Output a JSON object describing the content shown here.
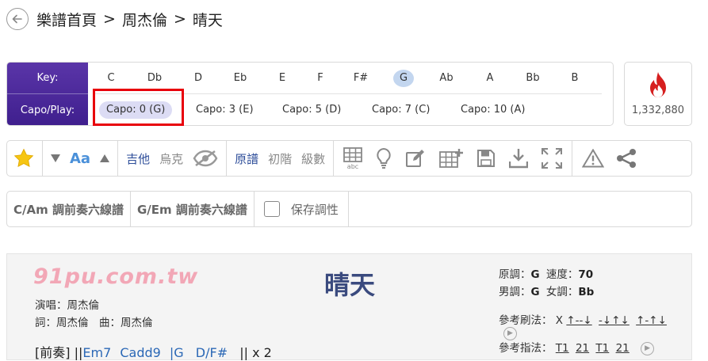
{
  "breadcrumb": {
    "back_icon": "arrow-left-icon",
    "items": [
      "樂譜首頁",
      "周杰倫",
      "晴天"
    ],
    "separator": ">"
  },
  "key_panel": {
    "key_label": "Key:",
    "capo_label": "Capo/Play:",
    "keys": [
      "C",
      "Db",
      "D",
      "Eb",
      "E",
      "F",
      "F#",
      "G",
      "Ab",
      "A",
      "Bb",
      "B"
    ],
    "selected_key": "G",
    "capo_options": [
      "Capo: 0 (G)",
      "Capo: 3 (E)",
      "Capo: 5 (D)",
      "Capo: 7 (C)",
      "Capo: 10 (A)"
    ],
    "selected_capo": "Capo: 0 (G)",
    "highlight_color": "#e8000b",
    "accent_color": "#4b2a9c"
  },
  "hot": {
    "icon": "fire-icon",
    "count": "1,332,880",
    "icon_color": "#d61f1f"
  },
  "toolbar": {
    "star_icon": "star-icon",
    "font_down_icon": "triangle-down-icon",
    "font_label": "Aa",
    "font_up_icon": "triangle-up-icon",
    "instruments": [
      "吉他",
      "烏克"
    ],
    "hide_icon": "eye-slash-icon",
    "levels": [
      "原譜",
      "初階",
      "級數"
    ],
    "tools": [
      "grid-abc-icon",
      "lightbulb-icon",
      "edit-icon",
      "table-add-icon",
      "save-icon",
      "download-icon",
      "fullscreen-icon",
      "warning-icon",
      "share-icon"
    ]
  },
  "options": {
    "items": [
      "C/Am 調前奏六線譜",
      "G/Em 調前奏六線譜"
    ],
    "save_key_label": "保存調性"
  },
  "sheet": {
    "logo": "91pu.com.tw",
    "title": "晴天",
    "singer": "演唱：周杰倫",
    "writers": "詞：周杰倫　曲：周杰倫",
    "original_key_label": "原調：",
    "original_key": "G",
    "tempo_label": "速度：",
    "tempo": "70",
    "male_key_label": "男調：",
    "male_key": "G",
    "female_key_label": "女調：",
    "female_key": "Bb",
    "strum_label": "參考刷法：",
    "strum_prefix": "X",
    "strum_patterns": [
      "↑--↓",
      "-↓↑↓",
      "↑-↑↓"
    ],
    "pick_label": "參考指法：",
    "pick_patterns": [
      "T1",
      "21",
      "T1",
      "21"
    ],
    "chord_line": {
      "section": "[前奏]",
      "bar_open": "||",
      "chords": [
        "Em7",
        "Cadd9",
        "|G",
        "D/F#"
      ],
      "bar_close": "||",
      "repeat": "x 2"
    }
  }
}
